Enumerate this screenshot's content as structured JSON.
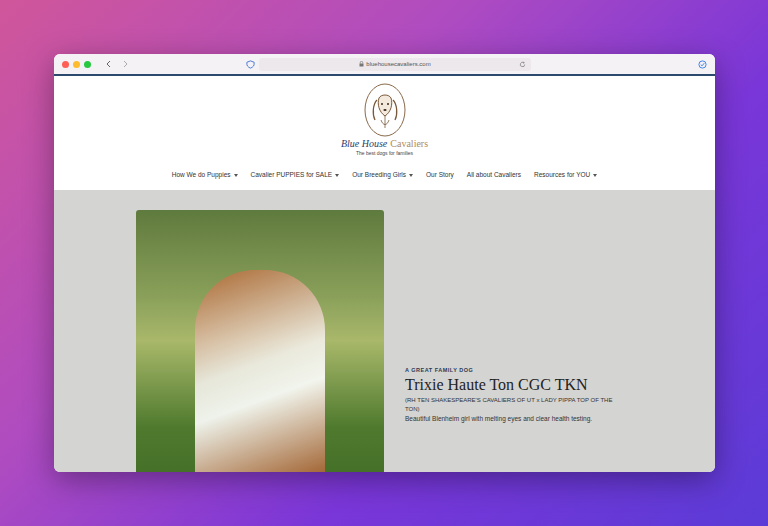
{
  "browser": {
    "url": "bluehousecavaliers.com"
  },
  "logo": {
    "name_first": "Blue House",
    "name_second": "Cavaliers",
    "tagline": "The best dogs for families"
  },
  "nav": [
    {
      "label": "How We do Puppies",
      "dropdown": true
    },
    {
      "label": "Cavalier PUPPIES for SALE",
      "dropdown": true
    },
    {
      "label": "Our Breeding Girls",
      "dropdown": true
    },
    {
      "label": "Our Story",
      "dropdown": false
    },
    {
      "label": "All about Cavaliers",
      "dropdown": false
    },
    {
      "label": "Resources for YOU",
      "dropdown": true
    }
  ],
  "hero": {
    "eyebrow": "A GREAT FAMILY DOG",
    "title": "Trixie Haute Ton CGC TKN",
    "pedigree": "(RH TEN SHAKESPEARE'S CAVALIERS OF UT x LADY PIPPA TOP OF THE TON)",
    "description": "Beautiful Blenheim girl with melting eyes and clear health testing."
  }
}
